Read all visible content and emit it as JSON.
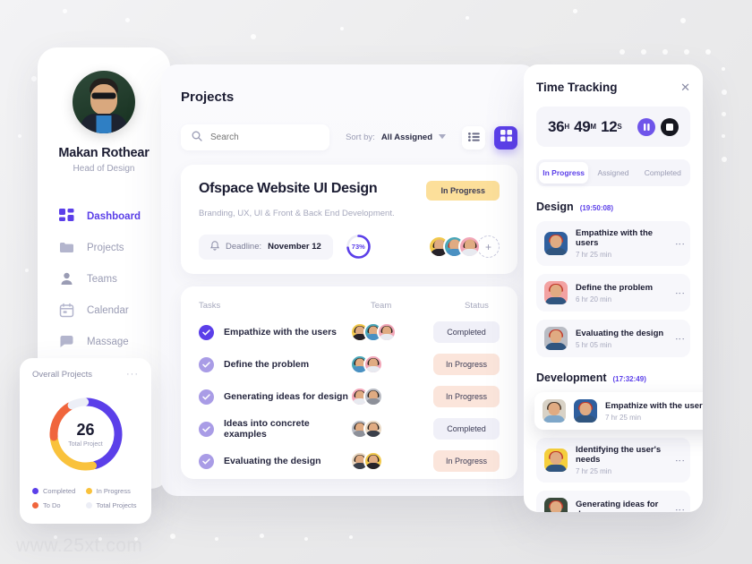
{
  "watermark": "www.25xt.com",
  "sidebar": {
    "profile": {
      "name": "Makan Rothear",
      "role": "Head of Design"
    },
    "items": [
      {
        "label": "Dashboard",
        "icon": "grid-icon",
        "active": true
      },
      {
        "label": "Projects",
        "icon": "folder-icon",
        "active": false
      },
      {
        "label": "Teams",
        "icon": "person-icon",
        "active": false
      },
      {
        "label": "Calendar",
        "icon": "calendar-icon",
        "active": false
      },
      {
        "label": "Massage",
        "icon": "chat-icon",
        "active": false
      }
    ]
  },
  "main": {
    "title": "Projects",
    "search_placeholder": "Search",
    "sort_label": "Sort by:",
    "sort_value": "All Assigned",
    "view_list": "list-view",
    "view_grid": "grid-view",
    "project": {
      "title": "Ofspace Website UI Design",
      "subtitle": "Branding, UX, UI & Front & Back End Development.",
      "status": "In Progress",
      "deadline_label": "Deadline:",
      "deadline_value": "November 12",
      "progress": "73%",
      "progress_pct": 73,
      "add_member": "+"
    },
    "table": {
      "headers": [
        "Tasks",
        "Team",
        "Status"
      ],
      "rows": [
        {
          "task": "Empathize with the users",
          "status": "Completed",
          "status_kind": "completed",
          "members": 3,
          "check": "done"
        },
        {
          "task": "Define the problem",
          "status": "In Progress",
          "status_kind": "inprogress",
          "members": 2,
          "check": "light"
        },
        {
          "task": "Generating ideas for design",
          "status": "In Progress",
          "status_kind": "inprogress",
          "members": 2,
          "check": "light"
        },
        {
          "task": "Ideas into concrete examples",
          "status": "Completed",
          "status_kind": "completed",
          "members": 2,
          "check": "light"
        },
        {
          "task": "Evaluating the design",
          "status": "In Progress",
          "status_kind": "inprogress",
          "members": 2,
          "check": "light"
        }
      ]
    }
  },
  "overall_projects": {
    "title": "Overall Projects",
    "menu": "···",
    "total": "26",
    "total_label": "Total Project",
    "legend": [
      {
        "label": "Completed",
        "color": "#5b3fe9"
      },
      {
        "label": "In Progress",
        "color": "#f9c23c"
      },
      {
        "label": "To Do",
        "color": "#f0653c"
      },
      {
        "label": "Total Projects",
        "color": "#eceef6"
      }
    ]
  },
  "chart_data": {
    "type": "pie",
    "title": "Overall Projects",
    "center_value": 26,
    "center_label": "Total Project",
    "categories": [
      "Completed",
      "In Progress",
      "To Do",
      "Total Projects"
    ],
    "values": [
      12,
      7,
      5,
      2
    ],
    "percentages": [
      46,
      27,
      19,
      8
    ],
    "colors": [
      "#5b3fe9",
      "#f9c23c",
      "#f0653c",
      "#eceef6"
    ],
    "legend_position": "bottom",
    "donut": true
  },
  "time_tracking": {
    "title": "Time Tracking",
    "close": "✕",
    "timer": {
      "hours": "36",
      "h_unit": "H",
      "minutes": "49",
      "m_unit": "M",
      "seconds": "12",
      "s_unit": "S"
    },
    "controls": {
      "pause": "pause-button",
      "stop": "stop-button"
    },
    "tabs": [
      {
        "label": "In Progress",
        "active": true
      },
      {
        "label": "Assigned",
        "active": false
      },
      {
        "label": "Completed",
        "active": false
      }
    ],
    "sections": [
      {
        "name": "Design",
        "time": "(19:50:08)",
        "items": [
          {
            "task": "Empathize with the users",
            "duration": "7 hr 25 min",
            "avatar_bg": "#2f5f9e",
            "floating": false
          },
          {
            "task": "Define the problem",
            "duration": "6 hr 20 min",
            "avatar_bg": "#f3a2a2",
            "floating": false
          },
          {
            "task": "Evaluating the design",
            "duration": "5 hr 05 min",
            "avatar_bg": "#b9bcc4",
            "floating": false
          }
        ]
      },
      {
        "name": "Development",
        "time": "(17:32:49)",
        "items": [
          {
            "task": "Empathize with the users",
            "duration": "7 hr 25 min",
            "avatar_bg": "#2f5f9e",
            "floating": true
          },
          {
            "task": "Identifying the user's needs",
            "duration": "7 hr 25 min",
            "avatar_bg": "#f5cf3c",
            "floating": false
          },
          {
            "task": "Generating ideas for de..",
            "duration": "",
            "avatar_bg": "#3a4a3c",
            "floating": false
          }
        ]
      }
    ]
  }
}
